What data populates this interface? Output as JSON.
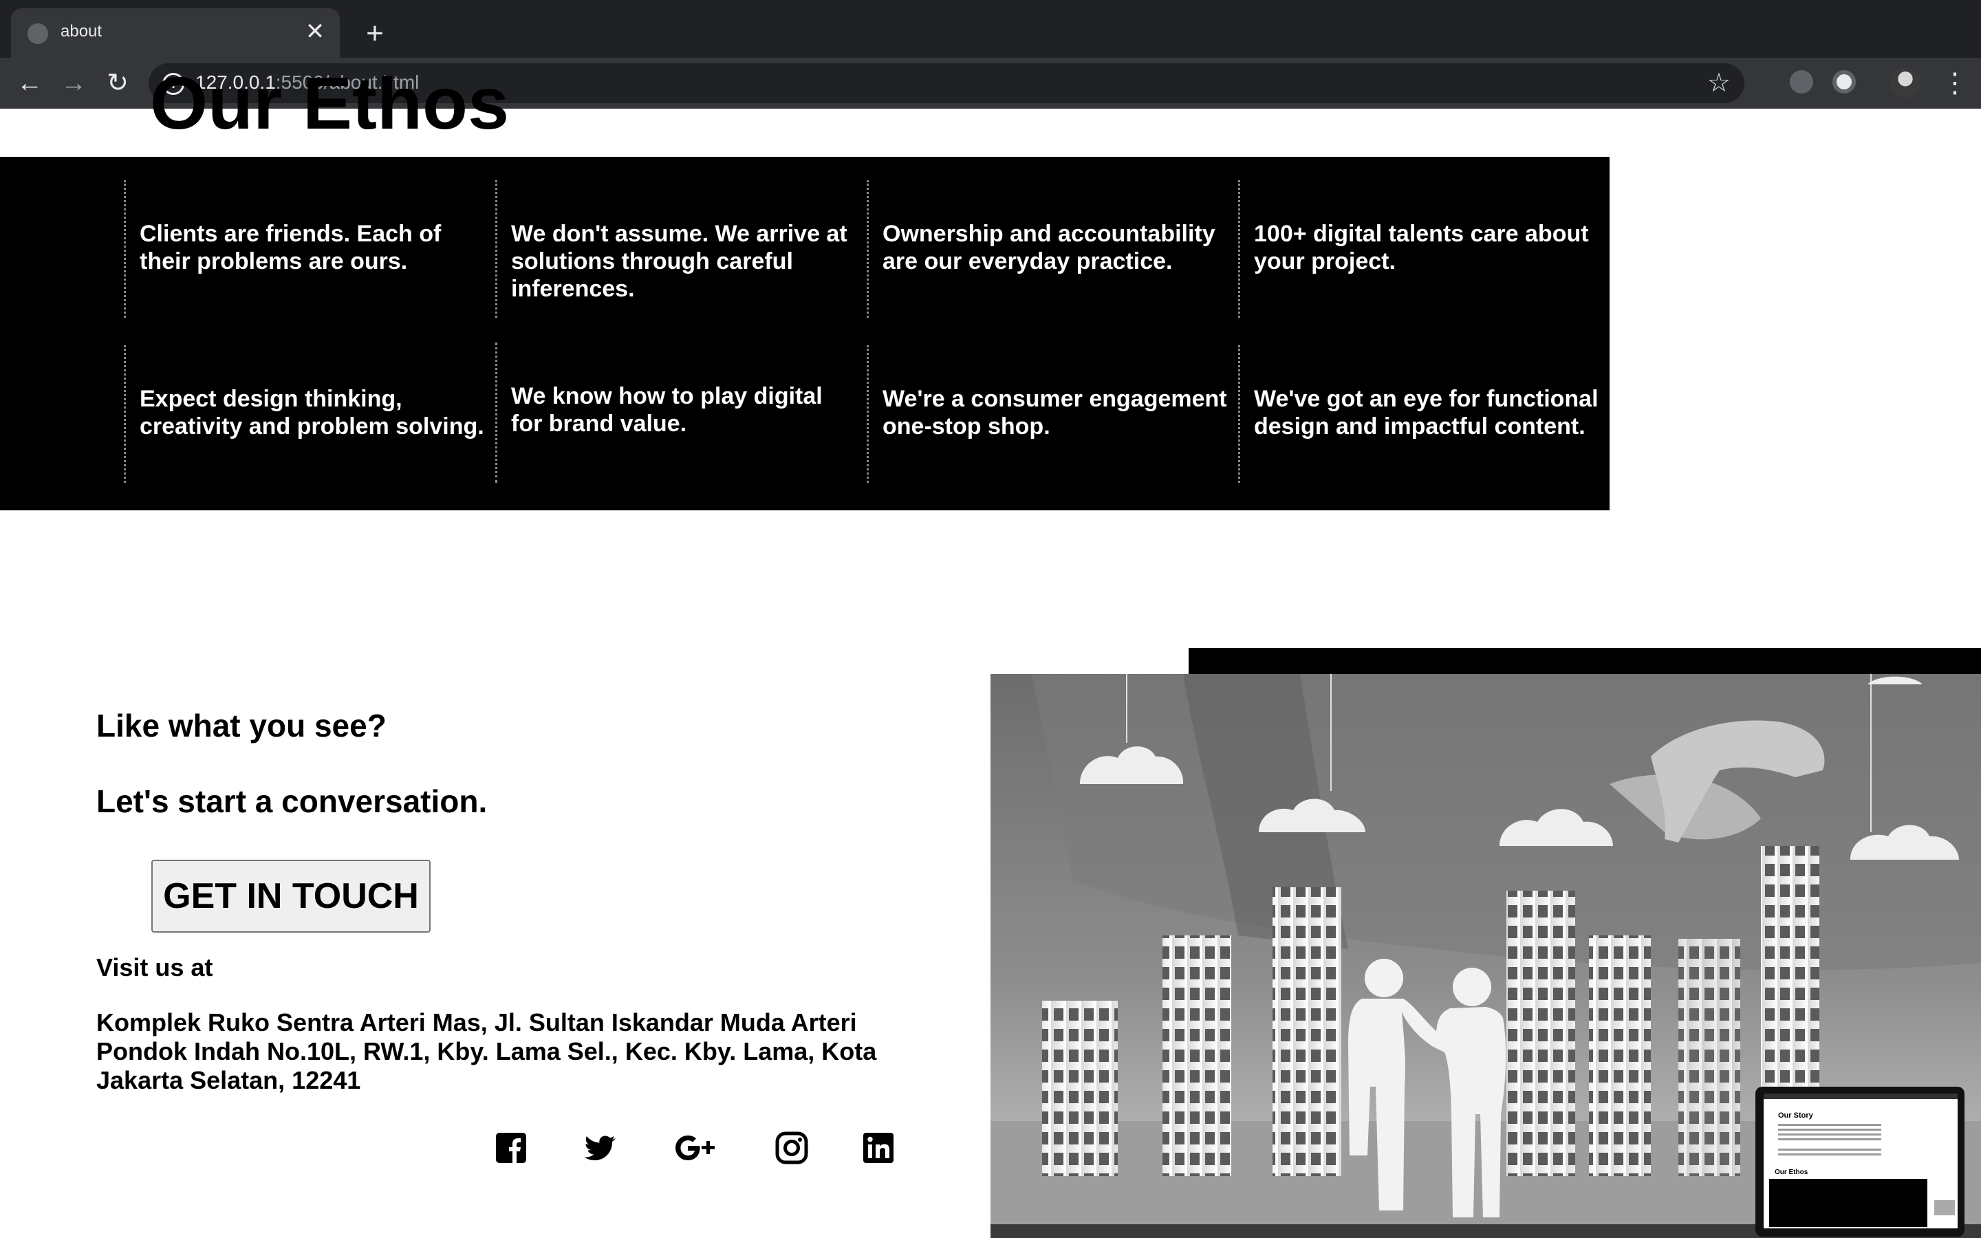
{
  "browser": {
    "tab_title": "about",
    "tab_close": "✕",
    "new_tab": "+",
    "url_host": "127.0.0.1",
    "url_rest": ":5500/about.html"
  },
  "page": {
    "ethos_heading": "Our Ethos",
    "ethos_items": [
      "Clients are friends. Each of their problems are ours.",
      "We don't assume. We arrive at solutions through careful inferences.",
      "Ownership and accountability are our everyday practice.",
      "100+ digital talents care about your project.",
      "Expect design thinking, creativity and problem solving.",
      "We know how to play digital for brand value.",
      "We're a consumer engagement one-stop shop.",
      "We've got an eye for functional design and impactful content."
    ],
    "cta_line1": "Like what you see?",
    "cta_line2": "Let's start a conversation.",
    "cta_button": "GET IN TOUCH",
    "visit_label": "Visit us at",
    "address": "Komplek Ruko Sentra Arteri Mas, Jl. Sultan Iskandar Muda Arteri Pondok Indah No.10L, RW.1, Kby. Lama Sel., Kec. Kby. Lama, Kota Jakarta Selatan, 12241",
    "social_icons": [
      "facebook-icon",
      "twitter-icon",
      "google-plus-icon",
      "instagram-icon",
      "linkedin-icon"
    ],
    "thumbnail": {
      "heading1": "Our Story",
      "heading2": "Our Ethos"
    }
  }
}
